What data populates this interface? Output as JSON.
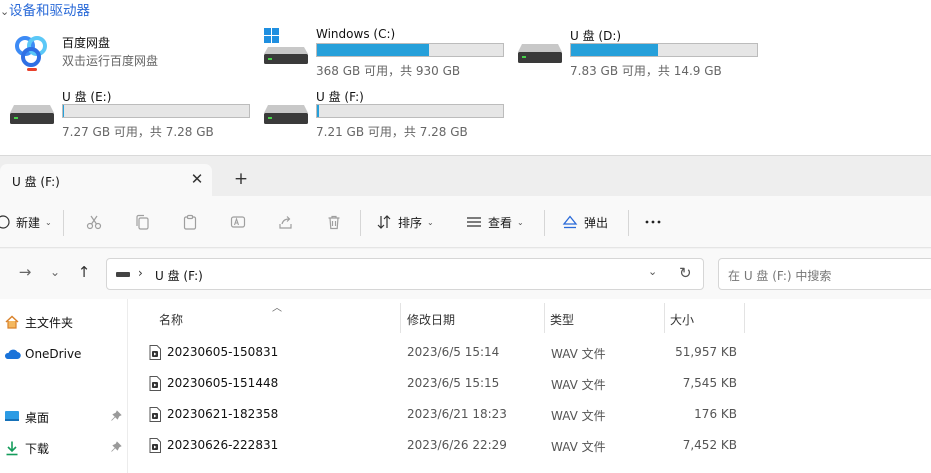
{
  "section_title": "设备和驱动器",
  "drives": [
    {
      "kind": "app",
      "name": "百度网盘",
      "info": "双击运行百度网盘",
      "icon": "baidu-netdisk-icon"
    },
    {
      "kind": "system",
      "name": "Windows (C:)",
      "info": "368 GB 可用，共 930 GB",
      "used_fraction": 0.6,
      "icon": "windows-drive-icon"
    },
    {
      "kind": "removable",
      "name": "U 盘 (D:)",
      "info": "7.83 GB 可用，共 14.9 GB",
      "used_fraction": 0.47,
      "icon": "drive-icon"
    },
    {
      "kind": "removable",
      "name": "U 盘 (E:)",
      "info": "7.27 GB 可用，共 7.28 GB",
      "used_fraction": 0.0014,
      "icon": "drive-icon"
    },
    {
      "kind": "removable",
      "name": "U 盘 (F:)",
      "info": "7.21 GB 可用，共 7.28 GB",
      "used_fraction": 0.01,
      "icon": "drive-icon"
    }
  ],
  "tab": {
    "title": "U 盘 (F:)"
  },
  "toolbar": {
    "new_label": "新建",
    "sort_label": "排序",
    "view_label": "查看",
    "eject_label": "弹出"
  },
  "address": {
    "crumb": "U 盘 (F:)"
  },
  "search": {
    "placeholder": "在 U 盘 (F:) 中搜索"
  },
  "nav": [
    {
      "label": "主文件夹",
      "icon": "home-icon"
    },
    {
      "label": "OneDrive",
      "icon": "cloud-icon"
    },
    {
      "label": "桌面",
      "icon": "desktop-icon",
      "pinned": true
    },
    {
      "label": "下载",
      "icon": "download-icon",
      "pinned": true
    }
  ],
  "columns": {
    "name": "名称",
    "modified": "修改日期",
    "type": "类型",
    "size": "大小"
  },
  "files": [
    {
      "name": "20230605-150831",
      "modified": "2023/6/5 15:14",
      "type": "WAV 文件",
      "size": "51,957 KB"
    },
    {
      "name": "20230605-151448",
      "modified": "2023/6/5 15:15",
      "type": "WAV 文件",
      "size": "7,545 KB"
    },
    {
      "name": "20230621-182358",
      "modified": "2023/6/21 18:23",
      "type": "WAV 文件",
      "size": "176 KB"
    },
    {
      "name": "20230626-222831",
      "modified": "2023/6/26 22:29",
      "type": "WAV 文件",
      "size": "7,452 KB"
    }
  ],
  "colors": {
    "accent": "#2a6ad8",
    "bar_fill": "#26a0da"
  }
}
